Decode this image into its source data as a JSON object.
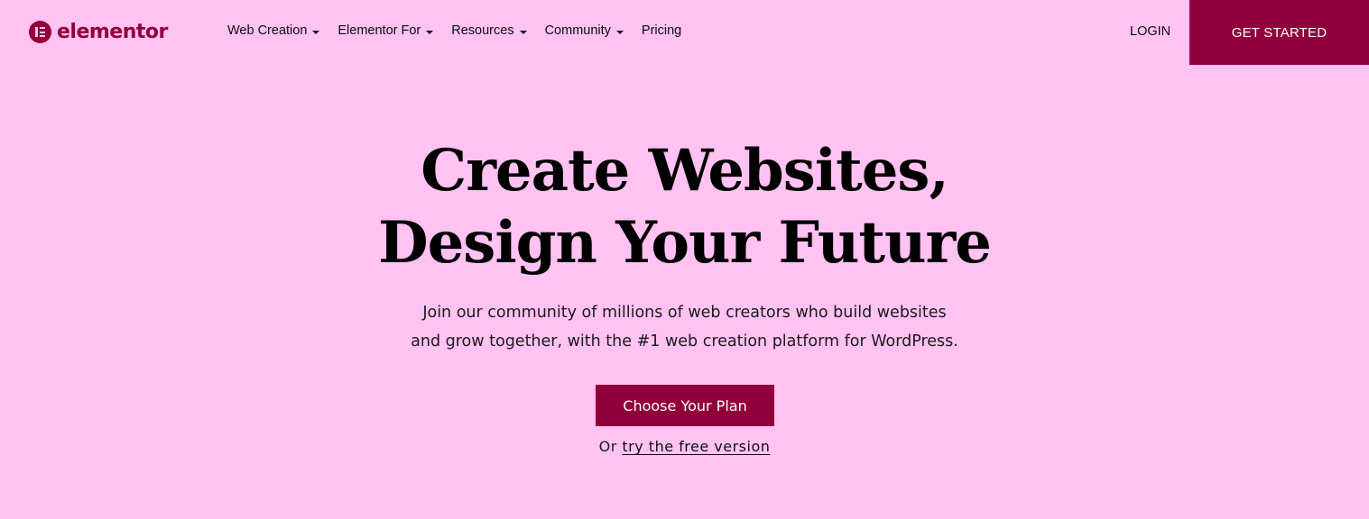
{
  "brand": {
    "name": "elementor",
    "logo_icon": "elementor-e-icon",
    "colors": {
      "background": "#FFC2F2",
      "accent": "#92003B",
      "text": "#0C0D0E",
      "button_text": "#FFFFFF"
    }
  },
  "header": {
    "nav": [
      {
        "label": "Web Creation",
        "has_dropdown": true,
        "icon": "caret-down-icon"
      },
      {
        "label": "Elementor For",
        "has_dropdown": true,
        "icon": "caret-down-icon"
      },
      {
        "label": "Resources",
        "has_dropdown": true,
        "icon": "caret-down-icon"
      },
      {
        "label": "Community",
        "has_dropdown": true,
        "icon": "caret-down-icon"
      },
      {
        "label": "Pricing",
        "has_dropdown": false
      }
    ],
    "login_label": "LOGIN",
    "get_started_label": "GET STARTED"
  },
  "hero": {
    "title_line1": "Create Websites,",
    "title_line2": "Design Your Future",
    "subtitle_line1": "Join our community of millions of web creators who build websites",
    "subtitle_line2": "and grow together, with the #1 web creation platform for WordPress.",
    "cta_label": "Choose Your Plan",
    "free_prefix": "Or",
    "free_link_label": "try the free version"
  }
}
